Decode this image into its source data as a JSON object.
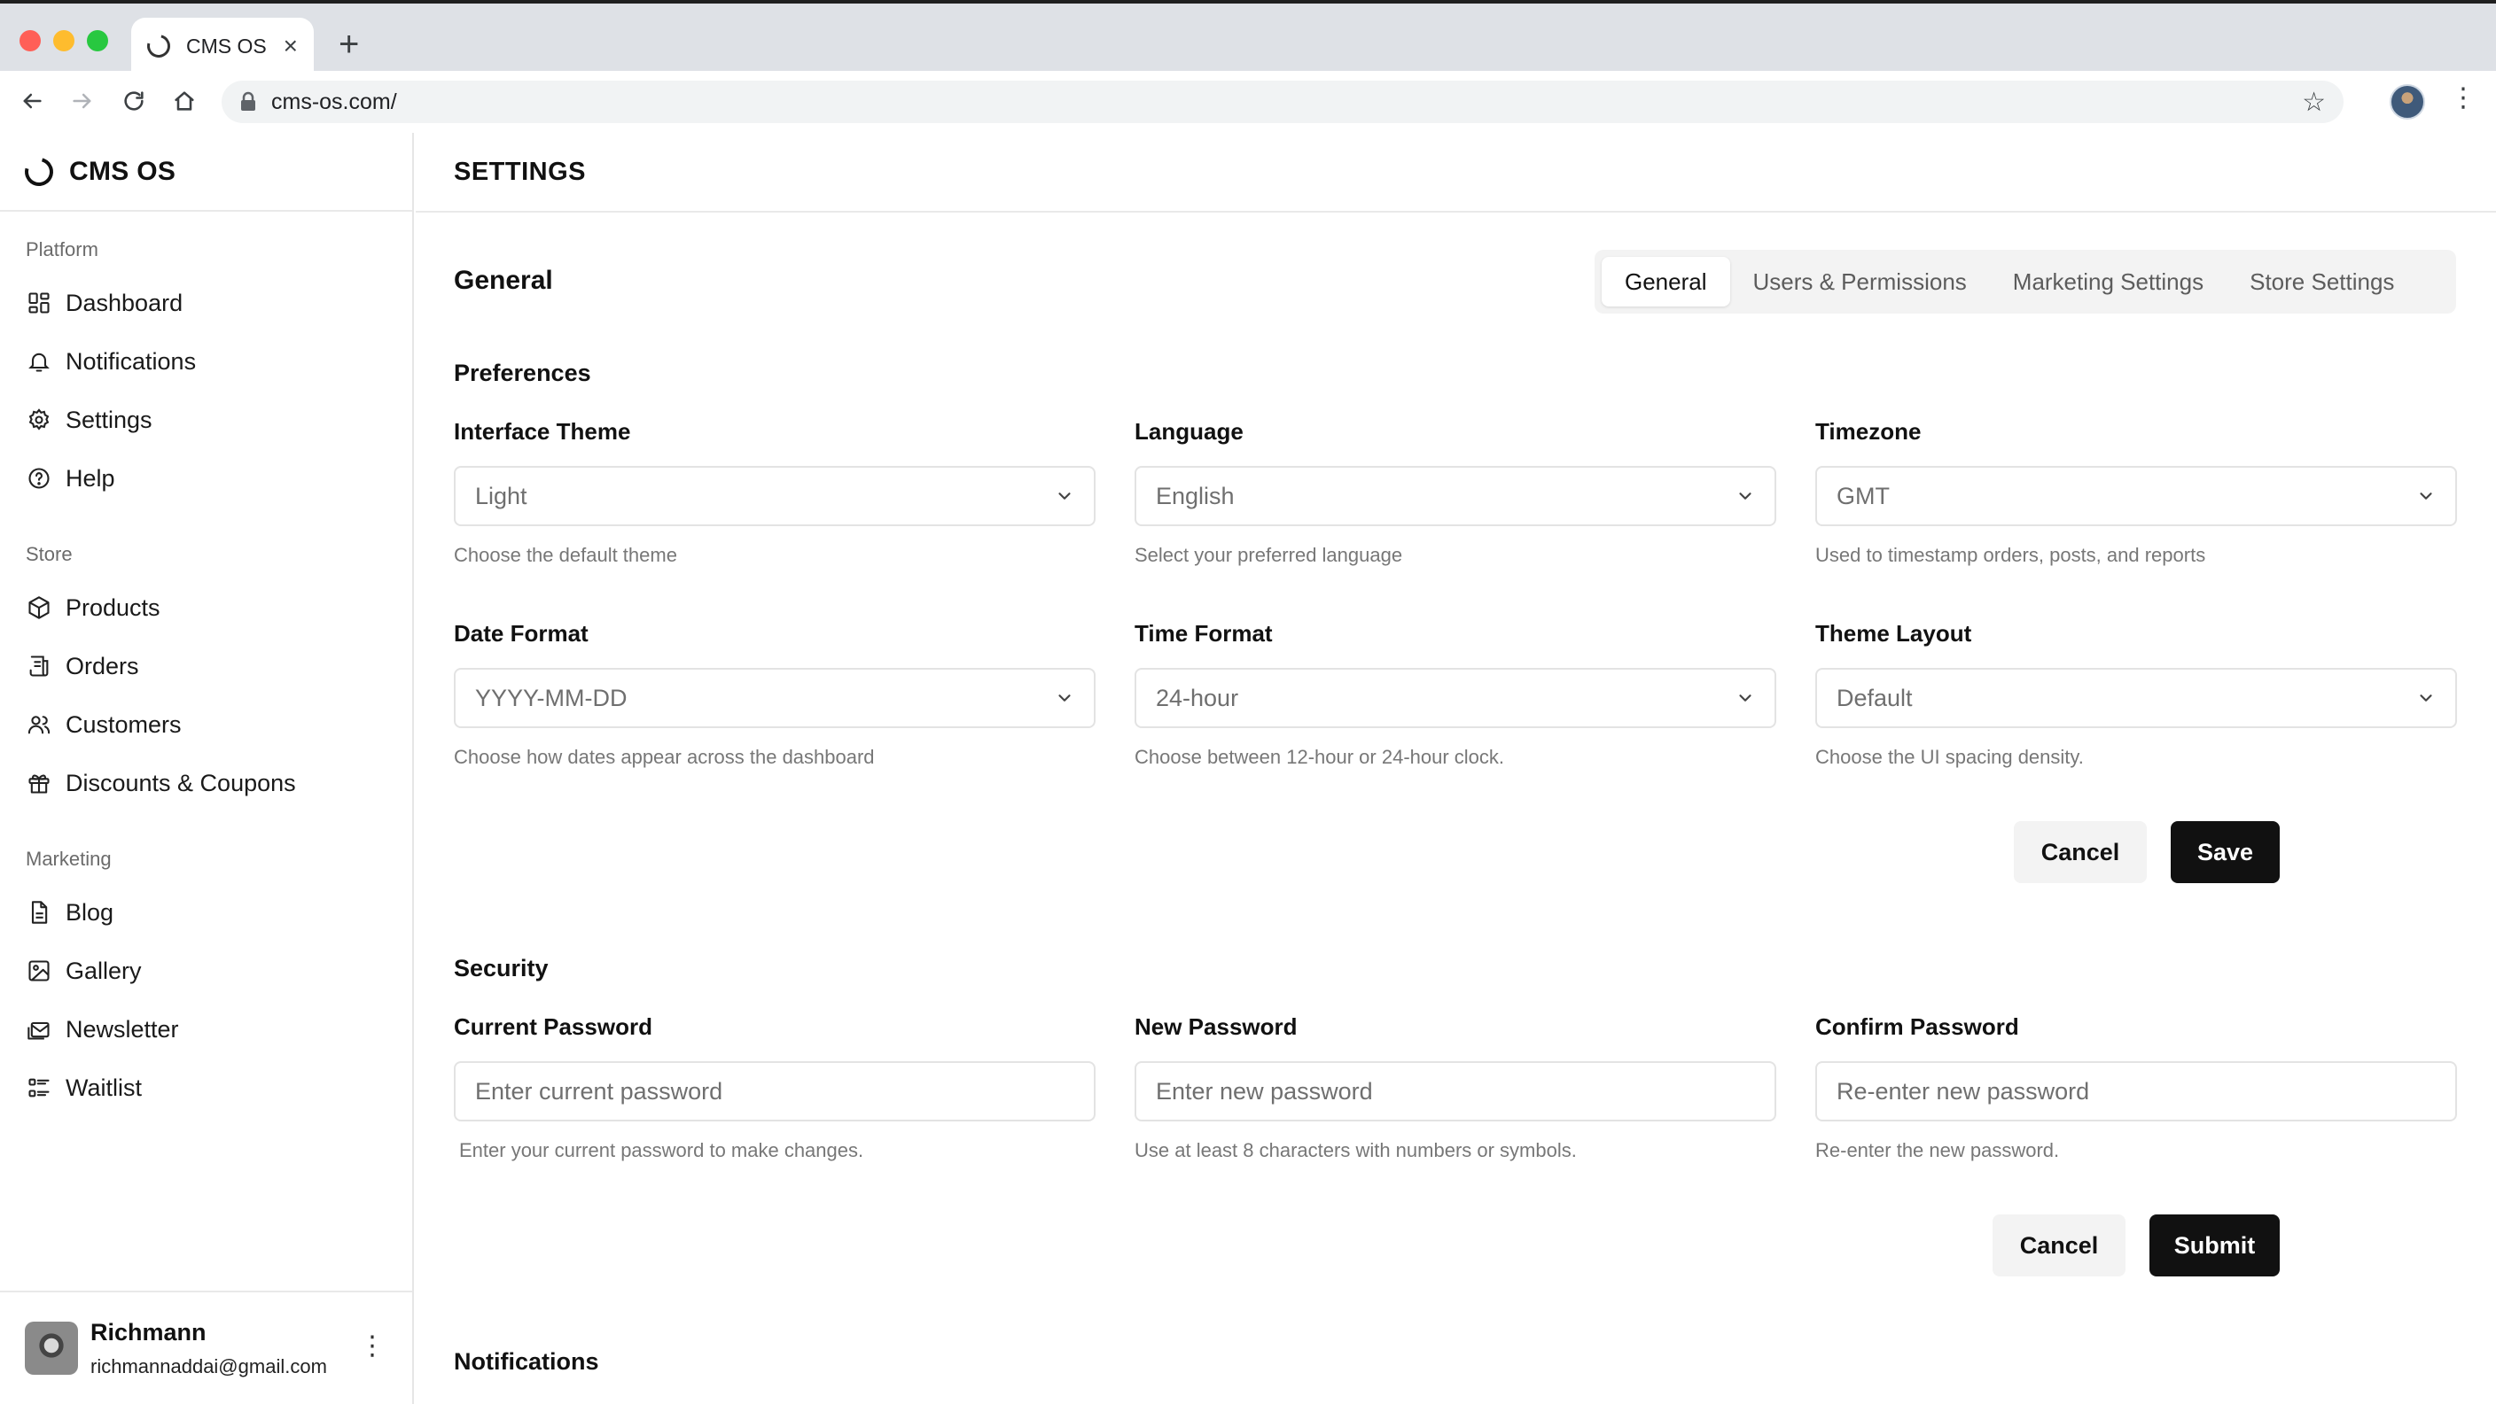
{
  "browser": {
    "tab_title": "CMS OS",
    "tab_close": "×",
    "new_tab": "+",
    "url": "cms-os.com/",
    "bookmark_star": "☆",
    "menu": "⋮"
  },
  "sidebar": {
    "brand": "CMS OS",
    "groups": [
      {
        "label": "Platform",
        "items": [
          {
            "label": "Dashboard",
            "icon": "dashboard-icon"
          },
          {
            "label": "Notifications",
            "icon": "bell-icon"
          },
          {
            "label": "Settings",
            "icon": "gear-icon"
          },
          {
            "label": "Help",
            "icon": "help-circle-icon"
          }
        ]
      },
      {
        "label": "Store",
        "items": [
          {
            "label": "Products",
            "icon": "box-icon"
          },
          {
            "label": "Orders",
            "icon": "receipt-icon"
          },
          {
            "label": "Customers",
            "icon": "users-icon"
          },
          {
            "label": "Discounts & Coupons",
            "icon": "gift-icon"
          }
        ]
      },
      {
        "label": "Marketing",
        "items": [
          {
            "label": "Blog",
            "icon": "document-icon"
          },
          {
            "label": "Gallery",
            "icon": "image-icon"
          },
          {
            "label": "Newsletter",
            "icon": "mail-icon"
          },
          {
            "label": "Waitlist",
            "icon": "list-icon"
          }
        ]
      }
    ],
    "user": {
      "name": "Richmann",
      "email": "richmannaddai@gmail.com",
      "menu": "⋮"
    }
  },
  "page": {
    "title": "SETTINGS",
    "section_heading": "General",
    "tabs": [
      {
        "label": "General",
        "active": true
      },
      {
        "label": "Users & Permissions",
        "active": false
      },
      {
        "label": "Marketing Settings",
        "active": false
      },
      {
        "label": "Store Settings",
        "active": false
      }
    ],
    "preferences": {
      "title": "Preferences",
      "fields": [
        {
          "label": "Interface Theme",
          "value": "Light",
          "help": "Choose the default theme"
        },
        {
          "label": "Language",
          "value": "English",
          "help": "Select your preferred language"
        },
        {
          "label": "Timezone",
          "value": "GMT",
          "help": "Used to timestamp orders, posts, and reports"
        },
        {
          "label": "Date Format",
          "value": "YYYY-MM-DD",
          "help": "Choose how dates appear across the dashboard"
        },
        {
          "label": "Time Format",
          "value": "24-hour",
          "help": "Choose between 12-hour or 24-hour clock."
        },
        {
          "label": "Theme Layout",
          "value": "Default",
          "help": "Choose the UI spacing density."
        }
      ],
      "cancel_label": "Cancel",
      "save_label": "Save"
    },
    "security": {
      "title": "Security",
      "fields": [
        {
          "label": "Current Password",
          "placeholder": "Enter current password",
          "help": "Enter your current password to make changes."
        },
        {
          "label": "New Password",
          "placeholder": "Enter new password",
          "help": "Use at least 8 characters with numbers or symbols."
        },
        {
          "label": "Confirm Password",
          "placeholder": "Re-enter new password",
          "help": "Re-enter the new password."
        }
      ],
      "cancel_label": "Cancel",
      "submit_label": "Submit"
    },
    "notifications": {
      "title": "Notifications"
    }
  }
}
